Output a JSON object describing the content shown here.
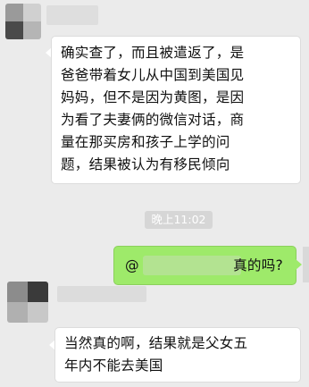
{
  "messages": [
    {
      "sender": "other",
      "lines": [
        "确实查了，而且被遣返了，是",
        "爸爸带着女儿从中国到美国见",
        "妈妈，但不是因为黄图，是因",
        "为看了夫妻俩的微信对话，商",
        "量在那买房和孩子上学的问",
        "题，结果被认为有移民倾向"
      ]
    },
    {
      "sender": "self",
      "prefix": "@",
      "suffix": "真的吗?"
    },
    {
      "sender": "other",
      "lines": [
        "当然真的啊，结果就是父女五",
        "年内不能去美国"
      ]
    }
  ],
  "timestamp": "晚上11:02",
  "colors": {
    "background": "#ebebeb",
    "incoming": "#ffffff",
    "outgoing": "#9eea6a",
    "timestamp_bg": "#d6d6d6"
  }
}
